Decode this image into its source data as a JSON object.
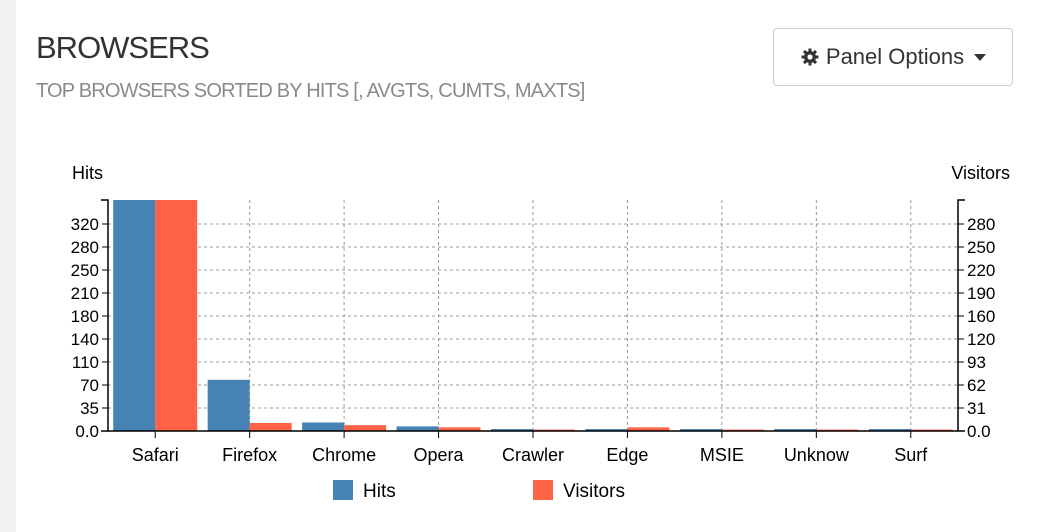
{
  "panel": {
    "title": "BROWSERS",
    "subtitle": "TOP BROWSERS SORTED BY HITS [, AVGTS, CUMTS, MAXTS]",
    "options_label": "Panel Options",
    "options_icon": "gear-icon"
  },
  "colors": {
    "hits": "#4682b4",
    "visitors": "#ff6347"
  },
  "chart_data": {
    "type": "bar",
    "categories": [
      "Safari",
      "Firefox",
      "Chrome",
      "Opera",
      "Crawler",
      "Edge",
      "MSIE",
      "Unknown",
      "Surf"
    ],
    "category_labels": [
      "Safari",
      "Firefox",
      "Chrome",
      "Opera",
      "Crawler",
      "Edge",
      "MSIE",
      "Unknow",
      "Surf"
    ],
    "series": [
      {
        "name": "Hits",
        "axis": "left",
        "values": [
          352,
          78,
          13,
          7,
          3,
          3,
          3,
          3,
          3
        ]
      },
      {
        "name": "Visitors",
        "axis": "right",
        "values": [
          316,
          11,
          8,
          5,
          2,
          5,
          2,
          2,
          2
        ]
      }
    ],
    "ylabel_left": "Hits",
    "ylabel_right": "Visitors",
    "ylim_left": [
      0,
      352
    ],
    "ylim_right": [
      0,
      316
    ],
    "yticks_left": [
      "0.0",
      "35",
      "70",
      "110",
      "140",
      "180",
      "210",
      "250",
      "280",
      "320"
    ],
    "yticks_right": [
      "0.0",
      "31",
      "62",
      "93",
      "120",
      "160",
      "190",
      "220",
      "250",
      "280"
    ],
    "grid": true,
    "legend": "bottom-center"
  }
}
